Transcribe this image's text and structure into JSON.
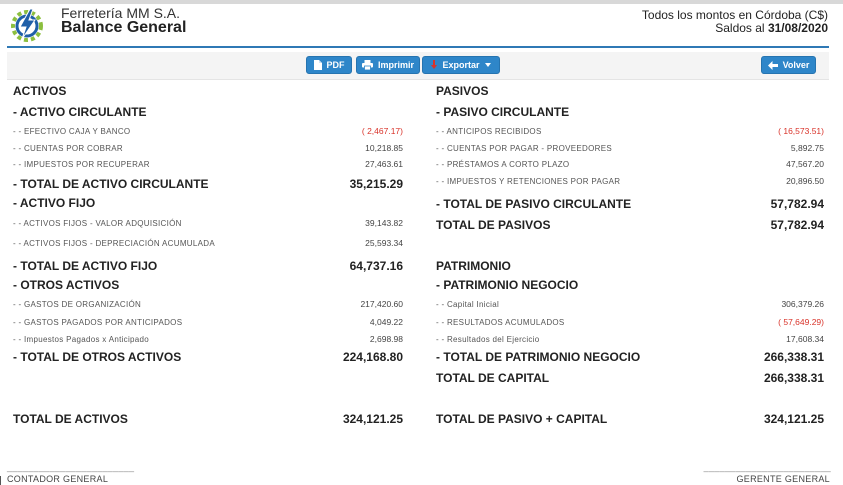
{
  "header": {
    "company": "Ferretería MM S.A.",
    "title": "Balance General",
    "currency_note": "Todos los montos en Córdoba (C$)",
    "balances_label": "Saldos al ",
    "balances_date": "31/08/2020"
  },
  "toolbar": {
    "pdf_label": "PDF",
    "print_label": "Imprimir",
    "export_label": "Exportar",
    "back_label": "Volver"
  },
  "colors": {
    "accent": "#2f79b5",
    "button": "#2e86c9",
    "negative": "#d9332a"
  },
  "activos": {
    "heading": "ACTIVOS",
    "circulante": {
      "title": "- ACTIVO CIRCULANTE",
      "items": [
        {
          "label": "- - EFECTIVO CAJA Y BANCO",
          "value": "( 2,467.17)",
          "negative": true
        },
        {
          "label": "- - CUENTAS POR COBRAR",
          "value": "10,218.85",
          "negative": false
        },
        {
          "label": "- - IMPUESTOS POR RECUPERAR",
          "value": "27,463.61",
          "negative": false
        }
      ],
      "total_label": "- TOTAL DE ACTIVO CIRCULANTE",
      "total_value": "35,215.29"
    },
    "fijo": {
      "title": "- ACTIVO FIJO",
      "items": [
        {
          "label": "- - ACTIVOS FIJOS - VALOR ADQUISICIÓN",
          "value": "39,143.82",
          "negative": false
        },
        {
          "label": "- - ACTIVOS FIJOS - DEPRECIACIÓN ACUMULADA",
          "value": "25,593.34",
          "negative": false
        }
      ],
      "total_label": "- TOTAL DE ACTIVO FIJO",
      "total_value": "64,737.16"
    },
    "otros": {
      "title": "- OTROS ACTIVOS",
      "items": [
        {
          "label": "- - GASTOS DE ORGANIZACIÓN",
          "value": "217,420.60",
          "negative": false
        },
        {
          "label": "- - GASTOS PAGADOS POR ANTICIPADOS",
          "value": "4,049.22",
          "negative": false
        },
        {
          "label": "- - Impuestos Pagados x Anticipado",
          "value": "2,698.98",
          "negative": false
        }
      ],
      "total_label": "- TOTAL DE OTROS ACTIVOS",
      "total_value": "224,168.80"
    },
    "grand_total_label": "TOTAL DE ACTIVOS",
    "grand_total_value": "324,121.25"
  },
  "pasivos": {
    "heading": "PASIVOS",
    "circulante": {
      "title": "- PASIVO CIRCULANTE",
      "items": [
        {
          "label": "- - ANTICIPOS RECIBIDOS",
          "value": "( 16,573.51)",
          "negative": true
        },
        {
          "label": "- - CUENTAS POR PAGAR - PROVEEDORES",
          "value": "5,892.75",
          "negative": false
        },
        {
          "label": "- - PRÉSTAMOS A CORTO PLAZO",
          "value": "47,567.20",
          "negative": false
        },
        {
          "label": "- - IMPUESTOS Y RETENCIONES POR PAGAR",
          "value": "20,896.50",
          "negative": false
        }
      ],
      "total_label": "- TOTAL DE PASIVO CIRCULANTE",
      "total_value": "57,782.94"
    },
    "total_label": "TOTAL DE PASIVOS",
    "total_value": "57,782.94"
  },
  "patrimonio": {
    "heading": "PATRIMONIO",
    "negocio": {
      "title": "- PATRIMONIO NEGOCIO",
      "items": [
        {
          "label": "- - Capital Inicial",
          "value": "306,379.26",
          "negative": false
        },
        {
          "label": "- - RESULTADOS ACUMULADOS",
          "value": "( 57,649.29)",
          "negative": true
        },
        {
          "label": "- - Resultados del Ejercicio",
          "value": "17,608.34",
          "negative": false
        }
      ],
      "total_label": "- TOTAL DE PATRIMONIO NEGOCIO",
      "total_value": "266,338.31"
    },
    "capital_label": "TOTAL DE CAPITAL",
    "capital_value": "266,338.31",
    "grand_total_label": "TOTAL DE PASIVO + CAPITAL",
    "grand_total_value": "324,121.25"
  },
  "signatures": {
    "left_line": "________________________",
    "left": "CONTADOR GENERAL",
    "right_line": "________________________",
    "right": "GERENTE GENERAL"
  }
}
